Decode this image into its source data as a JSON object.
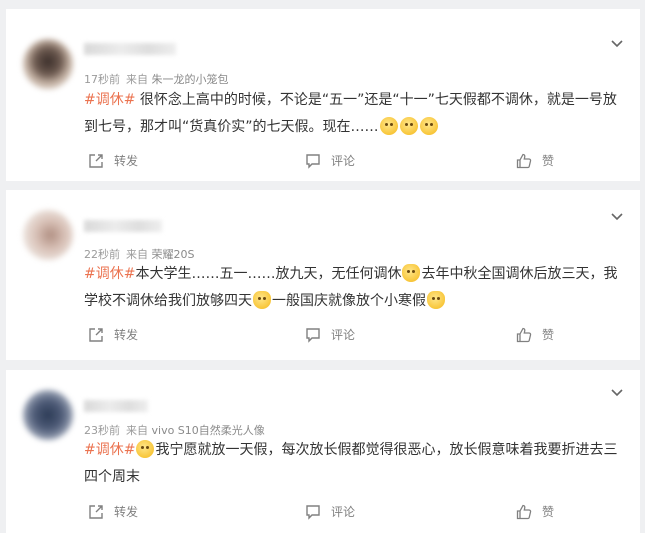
{
  "posts": [
    {
      "time": "17秒前",
      "source_prefix": "来自",
      "source": "朱一龙的小笼包",
      "tag": "#调休#",
      "text": " 很怀念上高中的时候，不论是“五一”还是“十一”七天假都不调休，就是一号放到七号，那才叫“货真价实”的七天假。现在……",
      "emojis": [
        "smile-emoji",
        "smile-emoji",
        "smile-emoji"
      ],
      "repost_label": "转发",
      "comment_label": "评论",
      "like_label": "赞"
    },
    {
      "time": "22秒前",
      "source_prefix": "来自",
      "source": "荣耀20S",
      "tag": "#调休#",
      "text_a": "本大学生……五一……放九天，无任何调休",
      "text_b": "去年中秋全国调休后放三天，我学校不调休给我们放够四天",
      "text_c": "一般国庆就像放个小寒假",
      "repost_label": "转发",
      "comment_label": "评论",
      "like_label": "赞"
    },
    {
      "time": "23秒前",
      "source_prefix": "来自",
      "source": "vivo S10自然柔光人像",
      "tag": "#调休#",
      "text": "我宁愿就放一天假，每次放长假都觉得很恶心，放长假意味着我要折进去三四个周末",
      "repost_label": "转发",
      "comment_label": "评论",
      "like_label": "赞"
    }
  ],
  "colors": {
    "tag": "#eb7350",
    "meta": "#9b9b9b",
    "text": "#333333",
    "background": "#eff0f2"
  }
}
